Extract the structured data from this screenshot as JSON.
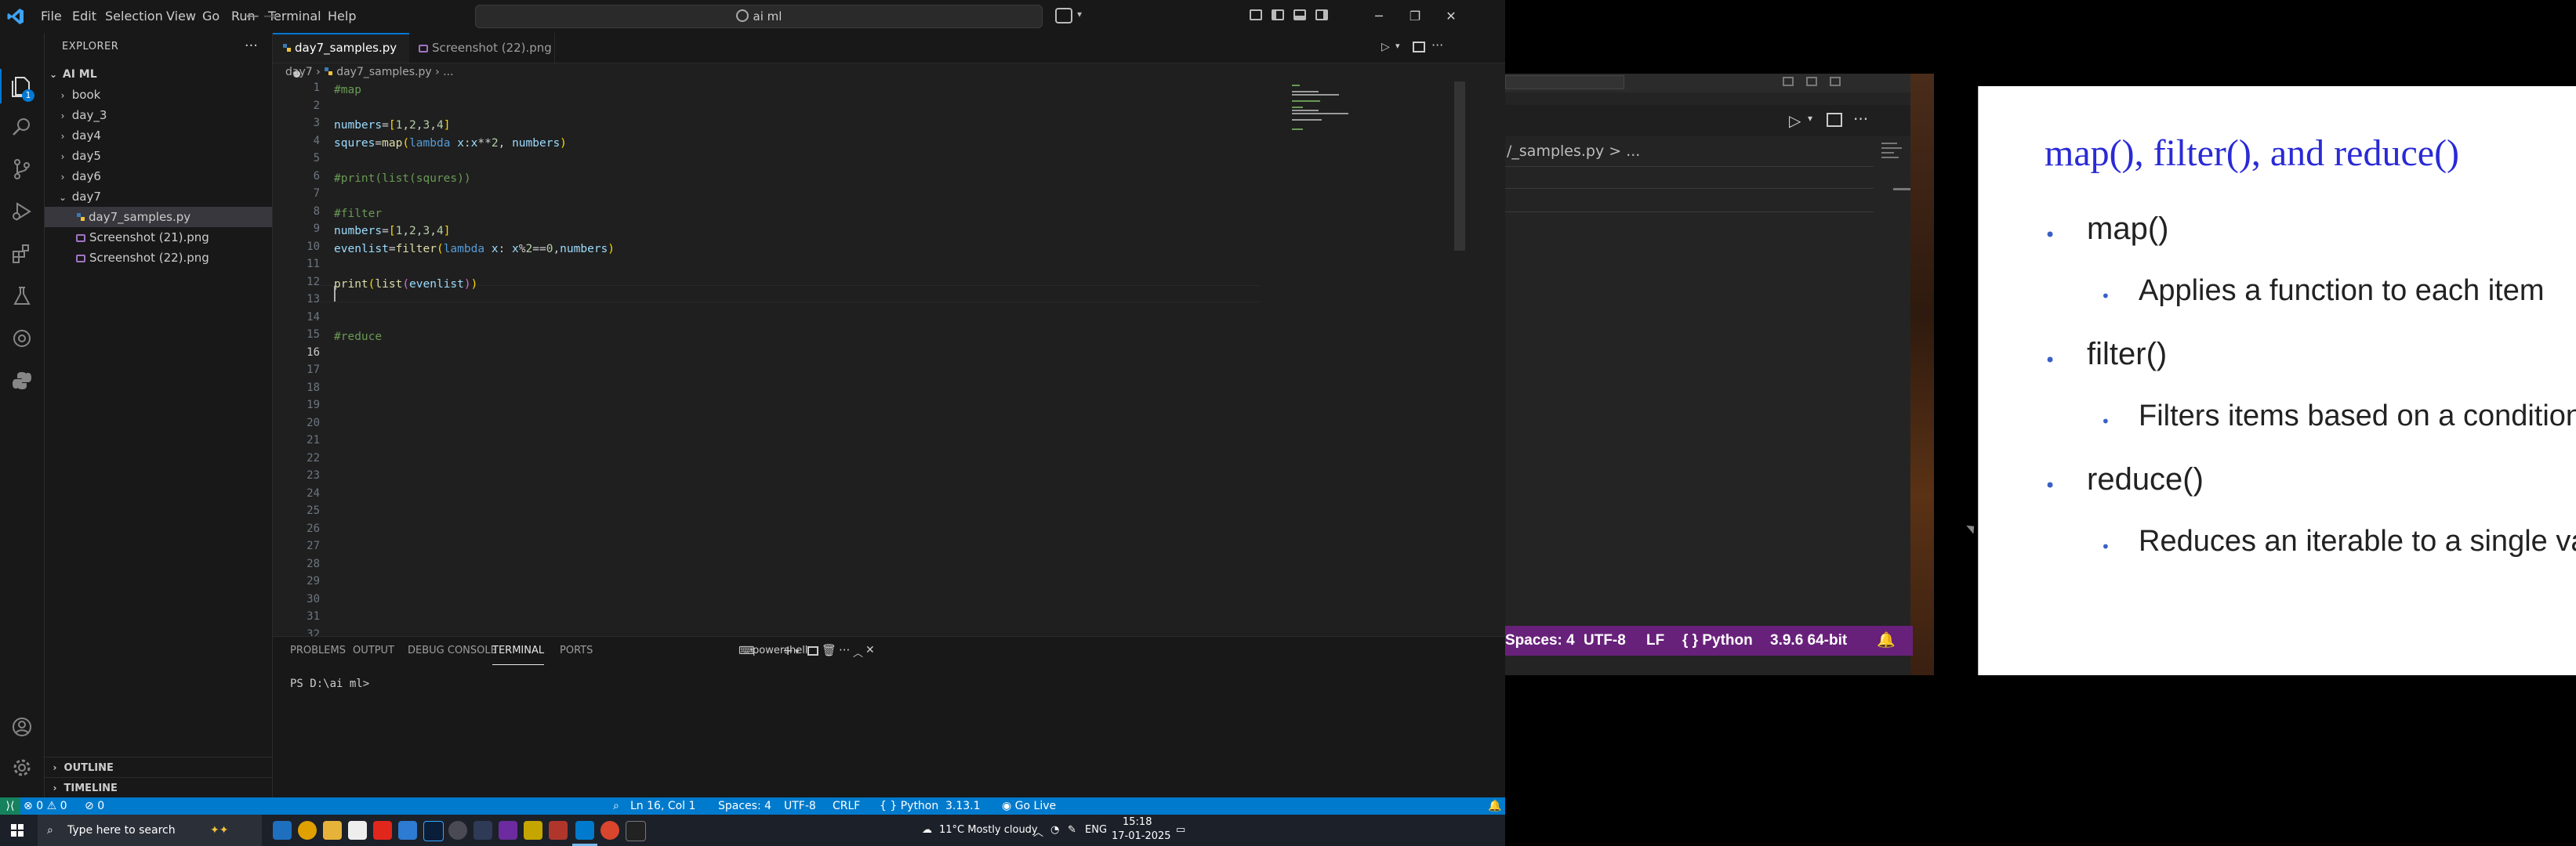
{
  "titlebar": {
    "menus": [
      "File",
      "Edit",
      "Selection",
      "View",
      "Go",
      "Run",
      "Terminal",
      "Help"
    ],
    "search_text": "ai ml"
  },
  "activitybar": {
    "explorer_badge": "1"
  },
  "sidebar": {
    "title": "EXPLORER",
    "root": "AI ML",
    "folders": [
      "book",
      "day_3",
      "day4",
      "day5",
      "day6"
    ],
    "open_folder": "day7",
    "files": [
      "day7_samples.py",
      "Screenshot (21).png",
      "Screenshot (22).png"
    ],
    "outline": "OUTLINE",
    "timeline": "TIMELINE"
  },
  "editor": {
    "tabs": [
      {
        "label": "day7_samples.py",
        "dirty": true
      },
      {
        "label": "Screenshot (22).png"
      }
    ],
    "breadcrumb": [
      "day7",
      "day7_samples.py",
      "..."
    ],
    "line_numbers": [
      "1",
      "2",
      "3",
      "4",
      "5",
      "6",
      "7",
      "8",
      "9",
      "10",
      "11",
      "12",
      "13",
      "14",
      "15",
      "16",
      "17",
      "18",
      "19",
      "20",
      "21",
      "22",
      "23",
      "24",
      "25",
      "26",
      "27",
      "28",
      "29",
      "30",
      "31",
      "32"
    ],
    "code_lines": [
      "#map",
      "",
      "numbers=[1,2,3,4]",
      "squres=map(lambda x:x**2, numbers)",
      "",
      "#print(list(squres))",
      "",
      "#filter",
      "numbers=[1,2,3,4]",
      "evenlist=filter(lambda x: x%2==0,numbers)",
      "",
      "print(list(evenlist))",
      "",
      "",
      "#reduce",
      ""
    ]
  },
  "panel": {
    "tabs": [
      "PROBLEMS",
      "OUTPUT",
      "DEBUG CONSOLE",
      "TERMINAL",
      "PORTS"
    ],
    "active_tab": "TERMINAL",
    "shell": "powershell",
    "terminal_text": "PS D:\\ai ml>"
  },
  "statusbar": {
    "errors": "0",
    "warnings": "0",
    "ports": "0",
    "position": "Ln 16, Col 1",
    "spaces": "Spaces: 4",
    "encoding": "UTF-8",
    "eol": "CRLF",
    "language": "Python",
    "version": "3.13.1",
    "golive": "Go Live"
  },
  "taskbar": {
    "search_placeholder": "Type here to search",
    "weather": "11°C  Mostly cloudy",
    "lang": "ENG",
    "time": "15:18",
    "date": "17-01-2025"
  },
  "shared": {
    "breadcrumb": "/_samples.py > ...",
    "status_items": [
      "Spaces: 4",
      "UTF-8",
      "LF",
      "{ } Python",
      "3.9.6 64-bit"
    ]
  },
  "slide": {
    "title": "map(), filter(), and reduce()",
    "items": [
      {
        "title": "map()",
        "desc": "Applies a function to each item"
      },
      {
        "title": "filter()",
        "desc": "Filters items based on a condition"
      },
      {
        "title": "reduce()",
        "desc": "Reduces an iterable to a single value"
      }
    ]
  },
  "colors": {
    "vscode_bg": "#1f1f1f",
    "statusbar": "#007acc",
    "inner_statusbar": "#68217a",
    "slide_title": "#2a2ad6"
  }
}
